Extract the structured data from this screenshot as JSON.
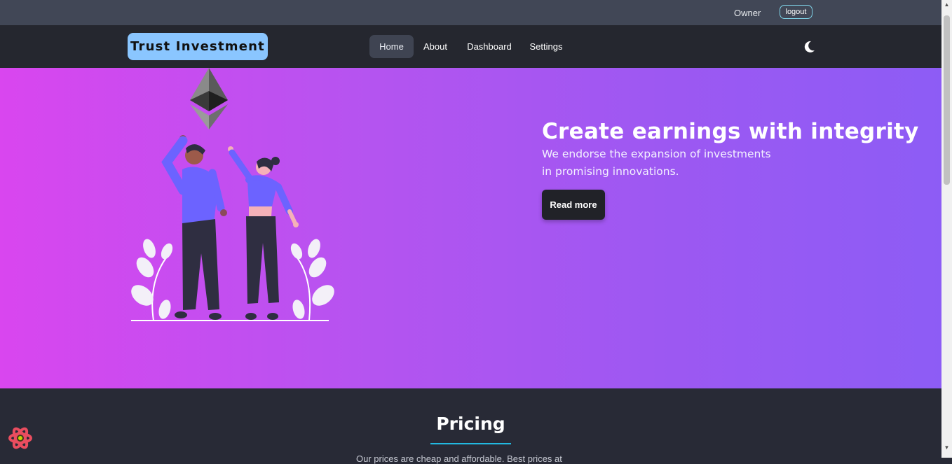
{
  "topbar": {
    "user": "Owner",
    "logout_label": "logout"
  },
  "navbar": {
    "brand": "Trust Investment",
    "links": [
      "Home",
      "About",
      "Dashboard",
      "Settings"
    ],
    "theme_icon": "moon-icon"
  },
  "hero": {
    "title": "Create earnings with integrity",
    "subtitle": "We endorse the expansion of investments in promising innovations.",
    "cta_label": "Read more",
    "illustration": "ethereum-people-illustration"
  },
  "pricing": {
    "title": "Pricing",
    "subtitle": "Our prices are cheap and affordable. Best prices at"
  },
  "colors": {
    "topbar": "#414756",
    "navbar": "#25272f",
    "brand_bg": "#8ac6ff",
    "hero_start": "#d946ef",
    "hero_end": "#8d5cf5",
    "page_bg": "#282a36",
    "accent": "#22b8e0"
  },
  "floating_icon": "react-icon"
}
